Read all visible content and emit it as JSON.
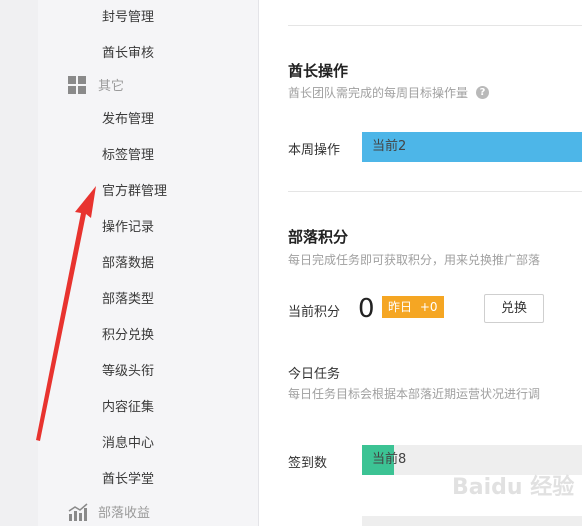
{
  "sidebar": {
    "items_top": [
      {
        "label": "封号管理"
      },
      {
        "label": "酋长审核"
      }
    ],
    "group_other": {
      "label": "其它",
      "icon": "grid-icon"
    },
    "items_other": [
      {
        "label": "发布管理"
      },
      {
        "label": "标签管理"
      },
      {
        "label": "官方群管理"
      },
      {
        "label": "操作记录"
      },
      {
        "label": "部落数据"
      },
      {
        "label": "部落类型"
      },
      {
        "label": "积分兑换"
      },
      {
        "label": "等级头衔"
      },
      {
        "label": "内容征集"
      },
      {
        "label": "消息中心"
      },
      {
        "label": "酋长学堂"
      }
    ],
    "group_income": {
      "label": "部落收益",
      "icon": "bar-chart-icon"
    }
  },
  "main": {
    "chief_ops": {
      "title": "酋长操作",
      "desc": "酋长团队需完成的每周目标操作量",
      "row_label": "本周操作",
      "bar_text": "当前2",
      "bar_color": "#4db6e8"
    },
    "tribe_points": {
      "title": "部落积分",
      "desc": "每日完成任务即可获取积分，用来兑换推广部落",
      "current_label": "当前积分",
      "current_value": "0",
      "yesterday_label": "昨日",
      "yesterday_value": "+0",
      "badge_color": "#f5a623",
      "exchange_button": "兑换"
    },
    "today_tasks": {
      "title": "今日任务",
      "desc": "每日任务目标会根据本部落近期运营状况进行调",
      "checkin_label": "签到数",
      "checkin_text": "当前8",
      "checkin_color": "#3cc394"
    }
  },
  "watermark": {
    "text": "Baidu 经验"
  }
}
